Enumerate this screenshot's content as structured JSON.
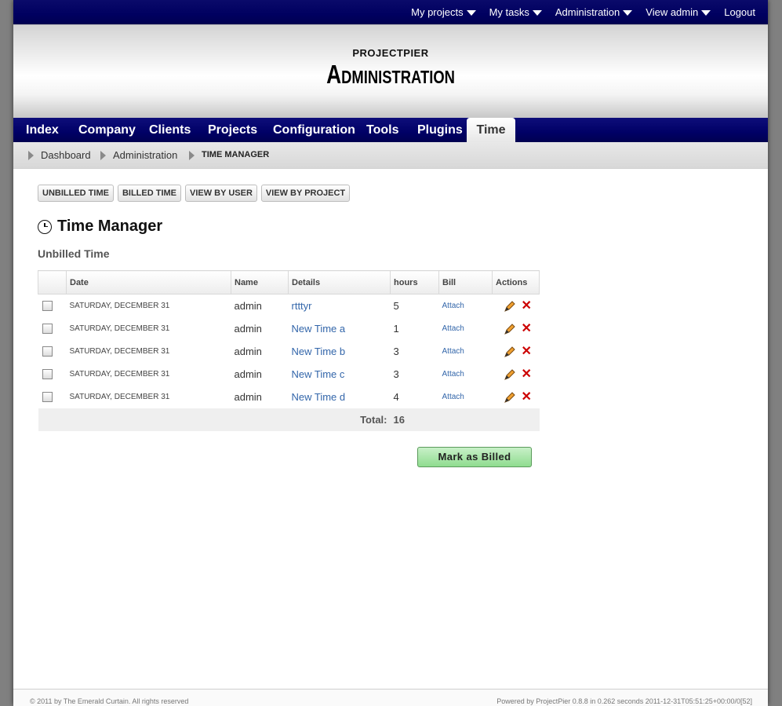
{
  "topmenu": {
    "my_projects": "My projects",
    "my_tasks": "My tasks",
    "administration": "Administration",
    "view_admin": "View admin",
    "logout": "Logout"
  },
  "header": {
    "site_name": "PROJECTPIER",
    "page_heading": "Administration"
  },
  "nav": {
    "tabs": [
      {
        "label": "Index"
      },
      {
        "label": "Company"
      },
      {
        "label": "Clients"
      },
      {
        "label": "Projects"
      },
      {
        "label": "Configuration"
      },
      {
        "label": "Tools"
      },
      {
        "label": "Plugins"
      },
      {
        "label": "Time",
        "active": true
      }
    ]
  },
  "breadcrumb": [
    "Dashboard",
    "Administration",
    "TIME MANAGER"
  ],
  "filters": [
    "UNBILLED TIME",
    "BILLED TIME",
    "VIEW BY USER",
    "VIEW BY PROJECT"
  ],
  "title": "Time Manager",
  "subtitle": "Unbilled Time",
  "table": {
    "headers": [
      "",
      "Date",
      "Name",
      "Details",
      "hours",
      "Bill",
      "Actions"
    ],
    "rows": [
      {
        "date": "SATURDAY, DECEMBER 31",
        "name": "admin",
        "details": "rtttyr",
        "hours": "5",
        "bill": "Attach"
      },
      {
        "date": "SATURDAY, DECEMBER 31",
        "name": "admin",
        "details": "New Time a",
        "hours": "1",
        "bill": "Attach"
      },
      {
        "date": "SATURDAY, DECEMBER 31",
        "name": "admin",
        "details": "New Time b",
        "hours": "3",
        "bill": "Attach"
      },
      {
        "date": "SATURDAY, DECEMBER 31",
        "name": "admin",
        "details": "New Time c",
        "hours": "3",
        "bill": "Attach"
      },
      {
        "date": "SATURDAY, DECEMBER 31",
        "name": "admin",
        "details": "New Time d",
        "hours": "4",
        "bill": "Attach"
      }
    ],
    "total_label": "Total:",
    "total_value": "16"
  },
  "mark_billed_label": "Mark as Billed",
  "footer": {
    "left": "© 2011 by The Emerald Curtain. All rights reserved",
    "right": "Powered by ProjectPier 0.8.8 in 0.262 seconds 2011-12-31T05:51:25+00:00/0[52]"
  },
  "colors": {
    "navbar": "#000066",
    "link": "#3366aa",
    "delete_icon": "#cc0000",
    "billed_button": "#8fdc8f"
  },
  "icons": {
    "topmenu_caret": "chevron-down-icon",
    "title": "clock-icon",
    "edit": "pencil-icon",
    "delete": "delete-x-icon",
    "breadcrumb_separator": "triangle-right-icon"
  }
}
